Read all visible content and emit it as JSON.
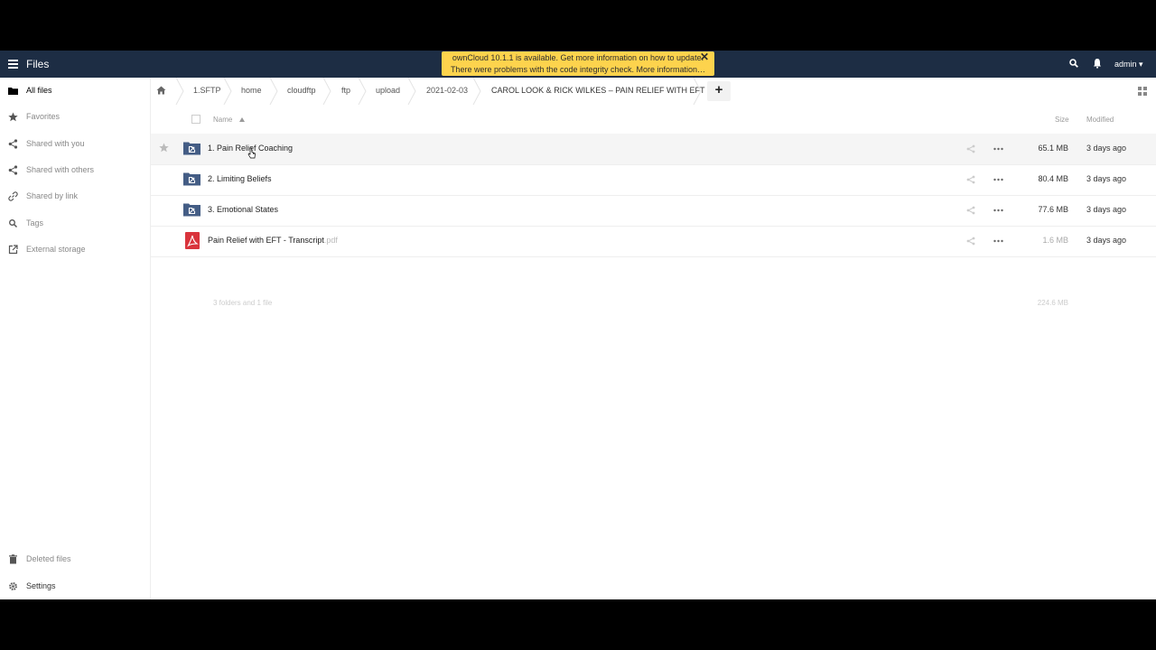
{
  "header": {
    "app_title": "Files",
    "user": "admin ▾",
    "notification": {
      "line1": "ownCloud 10.1.1 is available. Get more information on how to update.",
      "line2": "There were problems with the code integrity check. More information…",
      "close": "✕"
    }
  },
  "sidebar": {
    "items": [
      {
        "label": "All files",
        "icon": "folder-icon"
      },
      {
        "label": "Favorites",
        "icon": "star-icon"
      },
      {
        "label": "Shared with you",
        "icon": "share-icon"
      },
      {
        "label": "Shared with others",
        "icon": "share-icon"
      },
      {
        "label": "Shared by link",
        "icon": "link-icon"
      },
      {
        "label": "Tags",
        "icon": "tag-icon"
      },
      {
        "label": "External storage",
        "icon": "external-link-icon"
      }
    ],
    "bottom": [
      {
        "label": "Deleted files",
        "icon": "trash-icon"
      },
      {
        "label": "Settings",
        "icon": "gear-icon"
      }
    ]
  },
  "breadcrumb": [
    "1.SFTP",
    "home",
    "cloudftp",
    "ftp",
    "upload",
    "2021-02-03",
    "CAROL LOOK & RICK WILKES – PAIN RELIEF WITH EFT"
  ],
  "new_button": "+",
  "table": {
    "headers": {
      "name": "Name",
      "size": "Size",
      "modified": "Modified"
    },
    "rows": [
      {
        "name": "1. Pain Relief Coaching",
        "ext": "",
        "type": "folder",
        "size": "65.1 MB",
        "modified": "3 days ago"
      },
      {
        "name": "2. Limiting Beliefs",
        "ext": "",
        "type": "folder",
        "size": "80.4 MB",
        "modified": "3 days ago"
      },
      {
        "name": "3. Emotional States",
        "ext": "",
        "type": "folder",
        "size": "77.6 MB",
        "modified": "3 days ago"
      },
      {
        "name": "Pain Relief with EFT - Transcript",
        "ext": ".pdf",
        "type": "pdf",
        "size": "1.6 MB",
        "modified": "3 days ago"
      }
    ],
    "summary": "3 folders and 1 file",
    "summary_size": "224.6 MB"
  },
  "colors": {
    "header_bg": "#1d2d44",
    "notification_bg": "#fdd34d",
    "folder_icon": "#445d85",
    "pdf_icon": "#d9343c"
  }
}
